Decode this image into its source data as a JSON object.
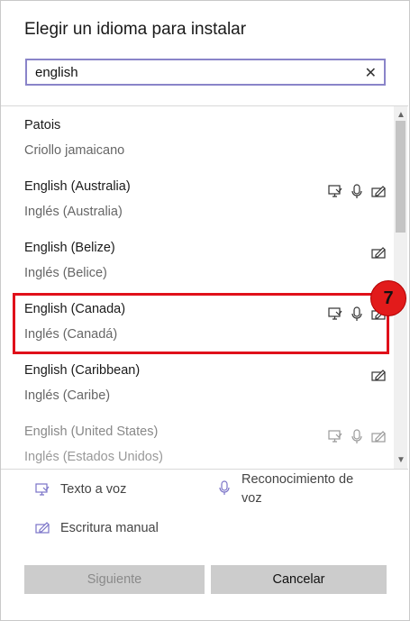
{
  "dialog": {
    "title": "Elegir un idioma para instalar",
    "search_value": "english"
  },
  "languages": [
    {
      "name": "Patois",
      "native": "Criollo jamaicano",
      "icons": []
    },
    {
      "name": "English (Australia)",
      "native": "Inglés (Australia)",
      "icons": [
        "text-to-speech-icon",
        "microphone-icon",
        "handwriting-icon"
      ]
    },
    {
      "name": "English (Belize)",
      "native": "Inglés (Belice)",
      "icons": [
        "handwriting-icon"
      ]
    },
    {
      "name": "English (Canada)",
      "native": "Inglés (Canadá)",
      "icons": [
        "text-to-speech-icon",
        "microphone-icon",
        "handwriting-icon"
      ]
    },
    {
      "name": "English (Caribbean)",
      "native": "Inglés (Caribe)",
      "icons": [
        "handwriting-icon"
      ]
    },
    {
      "name": "English (United States)",
      "native": "Inglés (Estados Unidos)",
      "icons": [
        "text-to-speech-icon",
        "microphone-icon",
        "handwriting-icon"
      ]
    }
  ],
  "annotation": {
    "number": "7",
    "color": "#e0101a"
  },
  "legend": {
    "tts": "Texto a voz",
    "speech_line1": "Reconocimiento de",
    "speech_line2": "voz",
    "handwriting": "Escritura manual"
  },
  "buttons": {
    "next": "Siguiente",
    "cancel": "Cancelar"
  },
  "colors": {
    "accent": "#8a84c9",
    "icon": "#7a73c7"
  }
}
